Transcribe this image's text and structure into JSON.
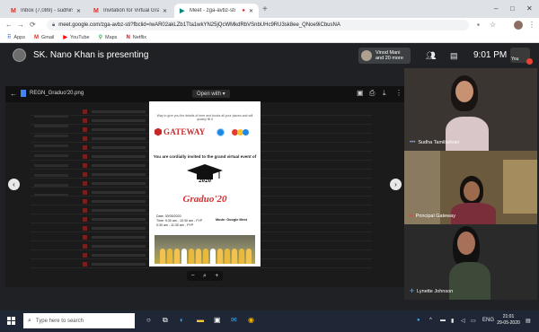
{
  "browser": {
    "tabs": [
      {
        "label": "Inbox (7,089) - sudhirsingamal...",
        "icon": "gmail-icon"
      },
      {
        "label": "Invitation for Virtual Graduation",
        "icon": "gmail-icon"
      },
      {
        "label": "Meet - zga-avbz-sti",
        "icon": "meet-icon"
      }
    ],
    "url": "meet.google.com/zga-avbz-sti?fbclid=IwAR02akLZb1Tta1wkYN25jQcWMkdRbVSnbUHc9RU3sk8ee_QNoe9iCbusNA",
    "bookmarks": [
      {
        "label": "Apps"
      },
      {
        "label": "Gmail"
      },
      {
        "label": "YouTube"
      },
      {
        "label": "Maps"
      },
      {
        "label": "Netflix"
      }
    ]
  },
  "meet": {
    "presenting_text": "SK. Nano Khan is presenting",
    "people_chip": {
      "line1": "Vinod Mani",
      "line2": "and 20 more"
    },
    "time": "9:01 PM",
    "self_label": "You",
    "participants": [
      {
        "name": "Sudha Tamilselvan"
      },
      {
        "name": "Principal Gateway"
      },
      {
        "name": "Lynette Johnson"
      }
    ]
  },
  "viewer": {
    "file_name": "REGN_Graduo'20.png",
    "open_with": "Open with ▾",
    "zoom_minus": "−",
    "zoom_search": "⌕",
    "zoom_plus": "+"
  },
  "poster": {
    "top_note": "Way to give you the details of here and books all your places and will quickly fill it",
    "brand": "GATEWAY",
    "invite": "You are cordially invited to the grand virtual event of",
    "year": "2020",
    "title": "Graduo'20",
    "date": "Date: 30/05/2020",
    "time1": "Time: 9:30 am - 10:30 am - FYP",
    "time2": "0:30 am - 11:30 am - PYP",
    "mode": "Mode: Google Meet"
  },
  "taskbar": {
    "search_placeholder": "Type here to search",
    "clock_time": "21:01",
    "clock_date": "29-05-2020",
    "lang": "ENG"
  },
  "colors": {
    "meet_bg": "#202124",
    "gateway_red": "#c62828",
    "title_red": "#d32f2f",
    "taskbar": "#1f2736"
  }
}
